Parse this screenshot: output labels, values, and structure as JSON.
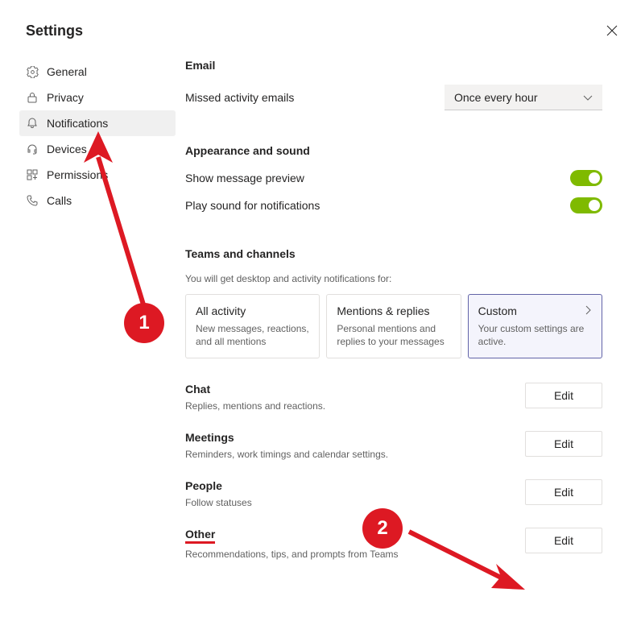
{
  "title": "Settings",
  "sidebar": {
    "items": [
      {
        "label": "General"
      },
      {
        "label": "Privacy"
      },
      {
        "label": "Notifications"
      },
      {
        "label": "Devices"
      },
      {
        "label": "Permissions"
      },
      {
        "label": "Calls"
      }
    ]
  },
  "email": {
    "heading": "Email",
    "missed_label": "Missed activity emails",
    "missed_value": "Once every hour"
  },
  "appearance": {
    "heading": "Appearance and sound",
    "preview_label": "Show message preview",
    "sound_label": "Play sound for notifications"
  },
  "teams": {
    "heading": "Teams and channels",
    "subtext": "You will get desktop and activity notifications for:",
    "cards": [
      {
        "title": "All activity",
        "desc": "New messages, reactions, and all mentions"
      },
      {
        "title": "Mentions & replies",
        "desc": "Personal mentions and replies to your messages"
      },
      {
        "title": "Custom",
        "desc": "Your custom settings are active."
      }
    ]
  },
  "sections": [
    {
      "title": "Chat",
      "desc": "Replies, mentions and reactions.",
      "btn": "Edit"
    },
    {
      "title": "Meetings",
      "desc": "Reminders, work timings and calendar settings.",
      "btn": "Edit"
    },
    {
      "title": "People",
      "desc": "Follow statuses",
      "btn": "Edit"
    },
    {
      "title": "Other",
      "desc": "Recommendations, tips, and prompts from Teams",
      "btn": "Edit"
    }
  ],
  "annotations": {
    "1": "1",
    "2": "2"
  }
}
